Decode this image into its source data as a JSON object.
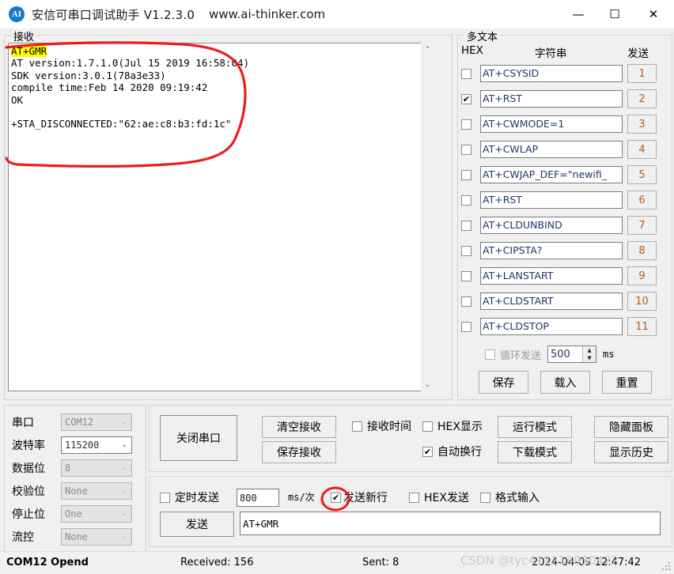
{
  "window": {
    "icon_label": "AI",
    "title": "安信可串口调试助手 V1.2.3.0",
    "url": "www.ai-thinker.com",
    "minimize": "—",
    "maximize": "☐",
    "close": "✕"
  },
  "receive": {
    "group_title": "接收",
    "selected_line": "AT+GMR",
    "body": "AT version:1.7.1.0(Jul 15 2019 16:58:04)\nSDK version:3.0.1(78a3e33)\ncompile time:Feb 14 2020 09:19:42\nOK\n\n+STA_DISCONNECTED:\"62:ae:c8:b3:fd:1c\"\n",
    "scroll_up": "⌃",
    "scroll_down": "⌄"
  },
  "multitext": {
    "group_title": "多文本",
    "col_hex": "HEX",
    "col_string": "字符串",
    "col_send": "发送",
    "rows": [
      {
        "checked": false,
        "command": "AT+CSYSID",
        "button": "1"
      },
      {
        "checked": true,
        "command": "AT+RST",
        "button": "2"
      },
      {
        "checked": false,
        "command": "AT+CWMODE=1",
        "button": "3"
      },
      {
        "checked": false,
        "command": "AT+CWLAP",
        "button": "4"
      },
      {
        "checked": false,
        "command": "AT+CWJAP_DEF=\"newifi_",
        "button": "5"
      },
      {
        "checked": false,
        "command": "AT+RST",
        "button": "6"
      },
      {
        "checked": false,
        "command": "AT+CLDUNBIND",
        "button": "7"
      },
      {
        "checked": false,
        "command": "AT+CIPSTA?",
        "button": "8"
      },
      {
        "checked": false,
        "command": "AT+LANSTART",
        "button": "9"
      },
      {
        "checked": false,
        "command": "AT+CLDSTART",
        "button": "10"
      },
      {
        "checked": false,
        "command": "AT+CLDSTOP",
        "button": "11"
      }
    ],
    "loop_send": {
      "checked": false,
      "label": "循环发送",
      "interval": "500",
      "unit": "ms"
    },
    "save_label": "保存",
    "load_label": "载入",
    "reset_label": "重置"
  },
  "serial": {
    "fields": [
      {
        "label": "串口",
        "value": "COM12",
        "enabled": false
      },
      {
        "label": "波特率",
        "value": "115200",
        "enabled": true
      },
      {
        "label": "数据位",
        "value": "8",
        "enabled": false
      },
      {
        "label": "校验位",
        "value": "None",
        "enabled": false
      },
      {
        "label": "停止位",
        "value": "One",
        "enabled": false
      },
      {
        "label": "流控",
        "value": "None",
        "enabled": false
      }
    ],
    "caret": "⌄"
  },
  "controls": {
    "close_port": "关闭串口",
    "clear_recv": "清空接收",
    "save_recv": "保存接收",
    "recv_time": {
      "label": "接收时间",
      "checked": false
    },
    "hex_display": {
      "label": "HEX显示",
      "checked": false
    },
    "auto_wrap": {
      "label": "自动换行",
      "checked": true
    },
    "run_mode": "运行模式",
    "download_mode": "下载模式",
    "hide_panel": "隐藏面板",
    "show_history": "显示历史"
  },
  "send": {
    "timed_send": {
      "label": "定时发送",
      "checked": false
    },
    "interval": "800",
    "interval_unit": "ms/次",
    "send_newline": {
      "label": "发送新行",
      "checked": true
    },
    "hex_send": {
      "label": "HEX发送",
      "checked": false
    },
    "format_input": {
      "label": "格式输入",
      "checked": false
    },
    "send_button": "发送",
    "send_value": "AT+GMR"
  },
  "statusbar": {
    "port_state": "COM12 Opend",
    "received": "Received: 156",
    "sent": "Sent: 8",
    "timestamp": "2024-04-09 12:47:42",
    "watermark": "CSDN @tyc411213930422",
    "grip": "⣿"
  },
  "colors": {
    "accent": "#1679c8",
    "annotation": "#ee1c1c",
    "highlight": "#ffff00",
    "command_text": "#1f3864",
    "button_number": "#c05a14"
  }
}
